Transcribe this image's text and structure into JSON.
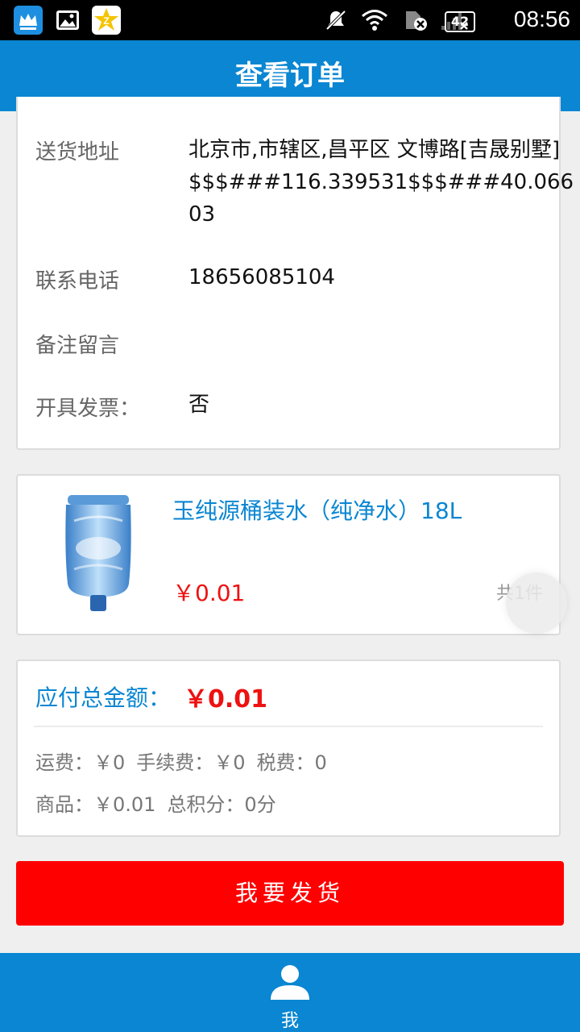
{
  "status_bar": {
    "time": "08:56",
    "battery": "42",
    "icons": [
      "crown-app-icon",
      "gallery-app-icon",
      "z-app-icon",
      "mute-icon",
      "wifi-icon",
      "sim-blocked-icon",
      "signal-icon",
      "battery-icon"
    ]
  },
  "header": {
    "title": "查看订单"
  },
  "order_info": {
    "address_label": "送货地址",
    "address_value": "北京市,市辖区,昌平区 文博路[吉晟别墅]$$$###116.339531$$$###40.06603",
    "phone_label": "联系电话",
    "phone_value": "18656085104",
    "note_label": "备注留言",
    "note_value": "",
    "invoice_label": "开具发票：",
    "invoice_value": "否"
  },
  "product": {
    "name": "玉纯源桶装水（纯净水）18L",
    "price": "￥0.01",
    "quantity": "共1件",
    "image_icon": "water-bottle-image"
  },
  "totals": {
    "total_label": "应付总金额：",
    "total_value": "￥0.01",
    "shipping": "运费：￥0",
    "handling": "手续费：￥0",
    "tax": "税费：0",
    "goods": "商品：￥0.01",
    "points": "总积分：0分"
  },
  "ship_button": {
    "label": "我要发货"
  },
  "bottom_nav": {
    "me_label": "我",
    "me_icon": "user-icon"
  },
  "colors": {
    "primary": "#0a86d2",
    "price": "#ee1111",
    "button": "#ff0000"
  }
}
